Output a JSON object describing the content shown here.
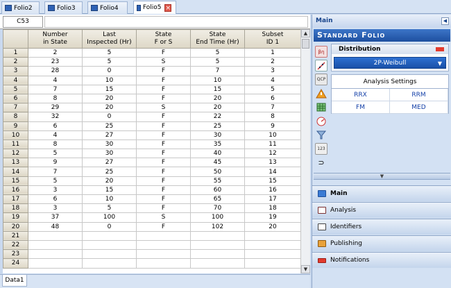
{
  "tabs": [
    {
      "label": "Folio2",
      "active": false
    },
    {
      "label": "Folio3",
      "active": false
    },
    {
      "label": "Folio4",
      "active": false
    },
    {
      "label": "Folio5",
      "active": true
    }
  ],
  "formula_bar": {
    "cell_ref": "C53",
    "value": ""
  },
  "grid": {
    "headers": [
      "",
      "Number\nin State",
      "Last\nInspected (Hr)",
      "State\nF or S",
      "State\nEnd Time (Hr)",
      "Subset\nID 1"
    ],
    "rows": [
      [
        "1",
        "2",
        "5",
        "F",
        "5",
        "1"
      ],
      [
        "2",
        "23",
        "5",
        "S",
        "5",
        "2"
      ],
      [
        "3",
        "28",
        "0",
        "F",
        "7",
        "3"
      ],
      [
        "4",
        "4",
        "10",
        "F",
        "10",
        "4"
      ],
      [
        "5",
        "7",
        "15",
        "F",
        "15",
        "5"
      ],
      [
        "6",
        "8",
        "20",
        "F",
        "20",
        "6"
      ],
      [
        "7",
        "29",
        "20",
        "S",
        "20",
        "7"
      ],
      [
        "8",
        "32",
        "0",
        "F",
        "22",
        "8"
      ],
      [
        "9",
        "6",
        "25",
        "F",
        "25",
        "9"
      ],
      [
        "10",
        "4",
        "27",
        "F",
        "30",
        "10"
      ],
      [
        "11",
        "8",
        "30",
        "F",
        "35",
        "11"
      ],
      [
        "12",
        "5",
        "30",
        "F",
        "40",
        "12"
      ],
      [
        "13",
        "9",
        "27",
        "F",
        "45",
        "13"
      ],
      [
        "14",
        "7",
        "25",
        "F",
        "50",
        "14"
      ],
      [
        "15",
        "5",
        "20",
        "F",
        "55",
        "15"
      ],
      [
        "16",
        "3",
        "15",
        "F",
        "60",
        "16"
      ],
      [
        "17",
        "6",
        "10",
        "F",
        "65",
        "17"
      ],
      [
        "18",
        "3",
        "5",
        "F",
        "70",
        "18"
      ],
      [
        "19",
        "37",
        "100",
        "S",
        "100",
        "19"
      ],
      [
        "20",
        "48",
        "0",
        "F",
        "102",
        "20"
      ],
      [
        "21",
        "",
        "",
        "",
        "",
        ""
      ],
      [
        "22",
        "",
        "",
        "",
        "",
        ""
      ],
      [
        "23",
        "",
        "",
        "",
        "",
        ""
      ],
      [
        "24",
        "",
        "",
        "",
        "",
        ""
      ]
    ]
  },
  "sheet_tab": "Data1",
  "panel": {
    "title": "Main",
    "banner": "Standard Folio",
    "distribution": {
      "label": "Distribution",
      "selected": "2P-Weibull"
    },
    "analysis": {
      "title": "Analysis Settings",
      "options": [
        "RRX",
        "RRM",
        "FM",
        "MED"
      ]
    },
    "nav": [
      "Main",
      "Analysis",
      "Identifiers",
      "Publishing",
      "Notifications"
    ],
    "icons": [
      "parameters-icon",
      "probability-plot-icon",
      "calculator-icon",
      "warning-icon",
      "table-icon",
      "gauge-icon",
      "funnel-icon",
      "numbers-icon",
      "transfer-icon"
    ]
  },
  "colors": {
    "accent": "#1d4f9f",
    "panel_bg": "#d3e1f3",
    "header_bg": "#ddd7c6"
  }
}
